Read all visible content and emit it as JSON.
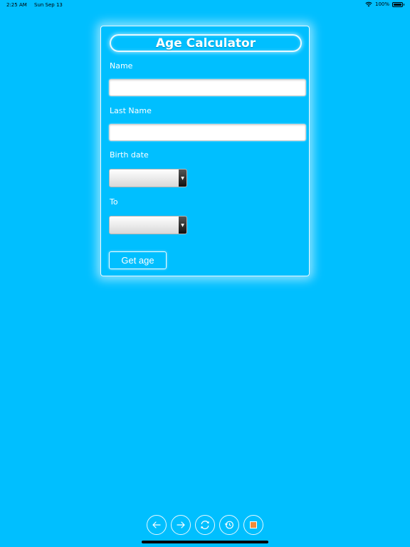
{
  "status_bar": {
    "time": "2:25 AM",
    "date": "Sun Sep 13",
    "battery": "100%",
    "icons": [
      "wifi-icon",
      "battery-icon"
    ]
  },
  "form": {
    "title": "Age Calculator",
    "name_label": "Name",
    "name_value": "",
    "last_name_label": "Last Name",
    "last_name_value": "",
    "birth_date_label": "Birth date",
    "birth_date_value": "",
    "to_label": "To",
    "to_value": "",
    "submit_label": "Get age"
  },
  "toolbar": {
    "buttons": [
      "back-arrow-icon",
      "forward-arrow-icon",
      "refresh-icon",
      "clock-icon",
      "stop-icon"
    ]
  },
  "colors": {
    "background": "#00BFFF",
    "accent": "#F08B3A",
    "text": "#FFFFFF"
  }
}
